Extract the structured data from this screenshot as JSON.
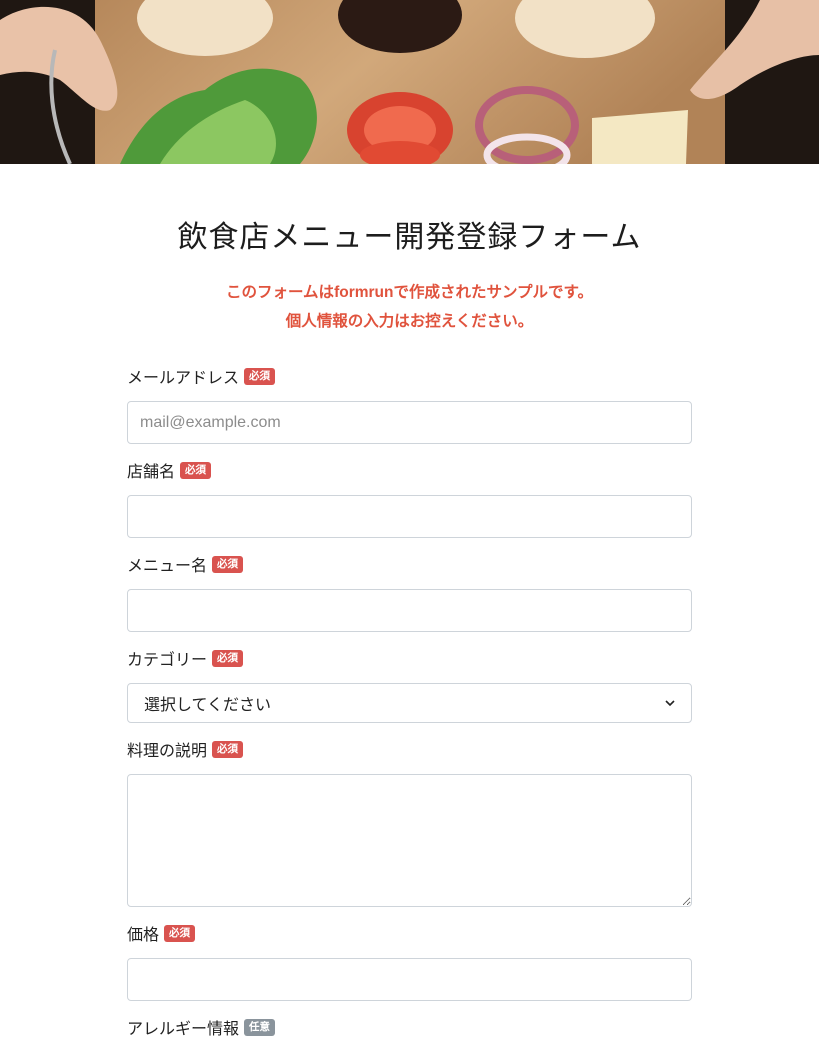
{
  "form": {
    "title": "飲食店メニュー開発登録フォーム",
    "notice_line1_pre": "このフォームは",
    "notice_brand": "formrun",
    "notice_line1_post": "で作成されたサンプルです。",
    "notice_line2": "個人情報の入力はお控えください。"
  },
  "fields": {
    "email": {
      "label": "メールアドレス",
      "badge": "必須",
      "placeholder": "mail@example.com"
    },
    "shop_name": {
      "label": "店舗名",
      "badge": "必須"
    },
    "menu_name": {
      "label": "メニュー名",
      "badge": "必須"
    },
    "category": {
      "label": "カテゴリー",
      "badge": "必須",
      "selected": "選択してください"
    },
    "description": {
      "label": "料理の説明",
      "badge": "必須"
    },
    "price": {
      "label": "価格",
      "badge": "必須"
    },
    "allergy": {
      "label": "アレルギー情報",
      "badge": "任意"
    }
  },
  "colors": {
    "accent": "#e0533d",
    "required_badge": "#d9534f",
    "optional_badge": "#8a949c"
  },
  "icons": {
    "select_arrow": "chevron-down-icon"
  }
}
